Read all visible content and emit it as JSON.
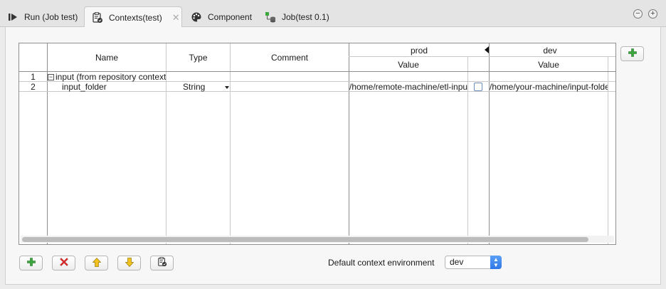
{
  "tabs": [
    {
      "label": "Run (Job test)",
      "icon": "run-icon"
    },
    {
      "label": "Contexts(test)",
      "icon": "contexts-icon",
      "active": true
    },
    {
      "label": "Component",
      "icon": "palette-icon"
    },
    {
      "label": "Job(test 0.1)",
      "icon": "job-icon"
    }
  ],
  "table": {
    "headers": {
      "name": "Name",
      "type": "Type",
      "comment": "Comment",
      "prod": "prod",
      "prod_value": "Value",
      "dev": "dev",
      "dev_value": "Value"
    },
    "rows": [
      {
        "num": "1",
        "name": "input (from repository context",
        "group": true
      },
      {
        "num": "2",
        "name": "input_folder",
        "type": "String",
        "comment": "",
        "prod_value": "/home/remote-machine/etl-input",
        "dev_value": "/home/your-machine/input-folder"
      }
    ]
  },
  "footer": {
    "default_env_label": "Default context environment",
    "default_env_value": "dev"
  },
  "colors": {
    "add": "#3aa83a",
    "remove": "#e03030",
    "arrow": "#f2c320",
    "accent": "#2f77e8"
  }
}
